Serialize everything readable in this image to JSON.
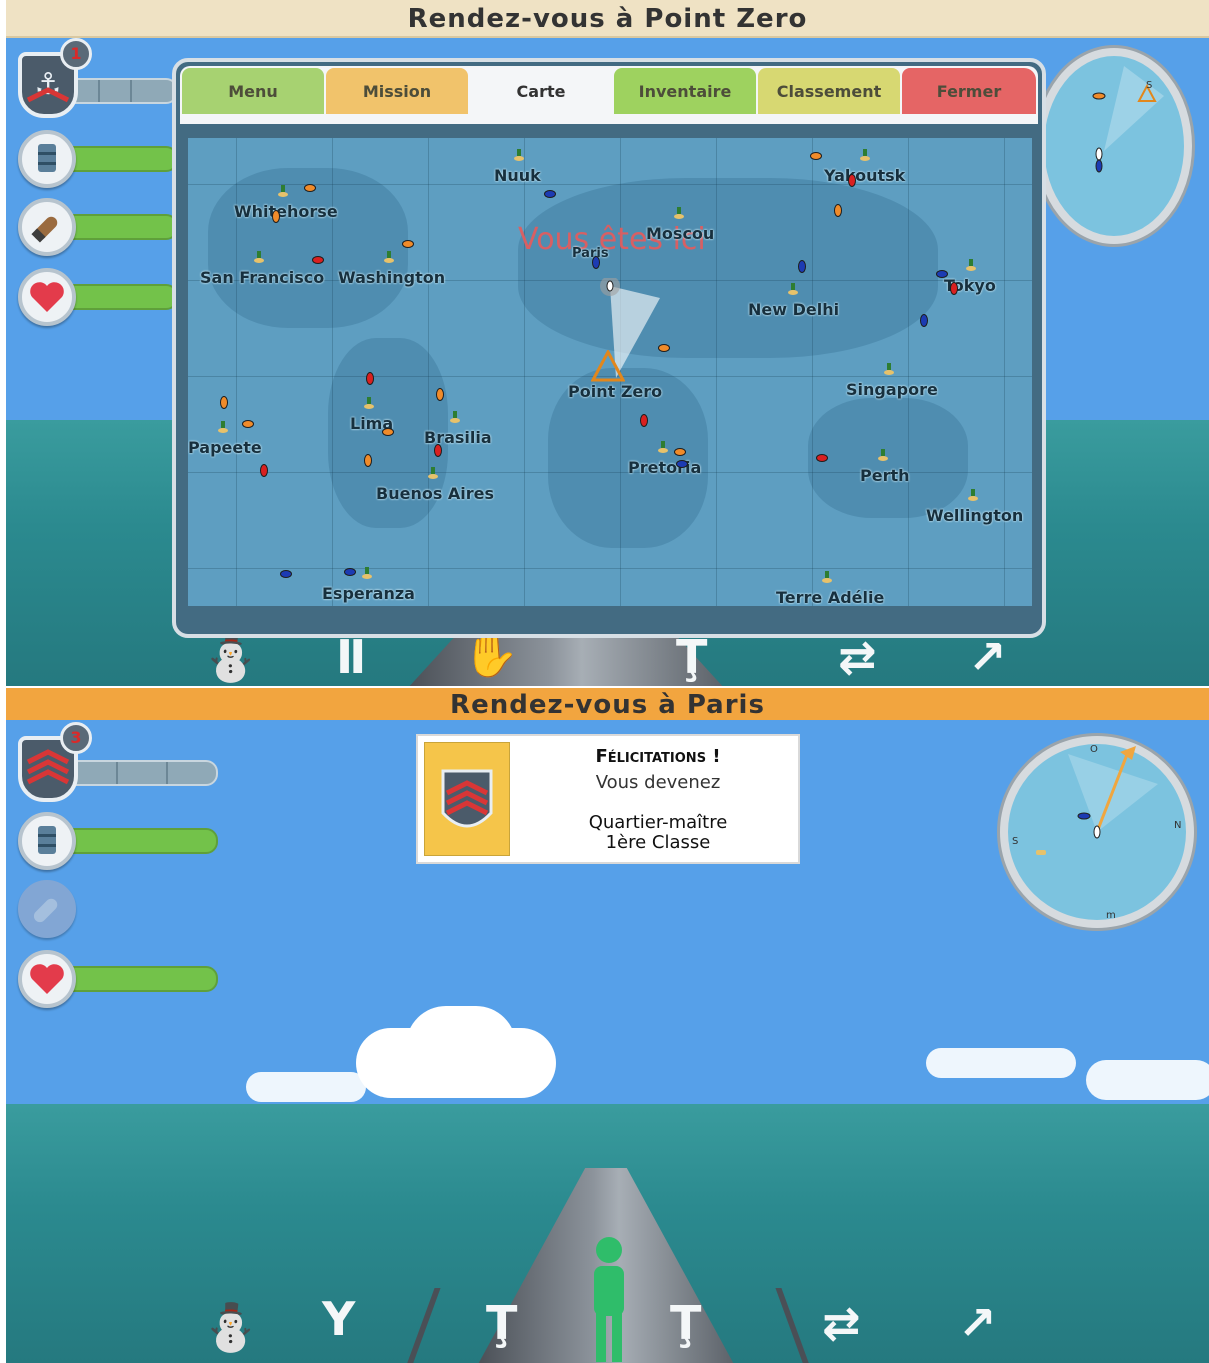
{
  "screen1": {
    "title": "Rendez-vous à Point Zero",
    "rank_badge_number": "1",
    "tabs": [
      {
        "label": "Menu",
        "color": "#a7d271"
      },
      {
        "label": "Mission",
        "color": "#f1c36b"
      },
      {
        "label": "Carte",
        "color": "#f4f6f8"
      },
      {
        "label": "Inventaire",
        "color": "#9ed25f"
      },
      {
        "label": "Classement",
        "color": "#d7d872"
      },
      {
        "label": "Fermer",
        "color": "#e56565"
      }
    ],
    "map": {
      "you_are_here": "Vous êtes ici",
      "cities": [
        "Nuuk",
        "Yakoutsk",
        "Whitehorse",
        "Moscou",
        "Paris",
        "San Francisco",
        "Washington",
        "Tokyo",
        "New Delhi",
        "Point Zero",
        "Singapore",
        "Papeete",
        "Lima",
        "Brasilia",
        "Pretoria",
        "Perth",
        "Buenos Aires",
        "Wellington",
        "Esperanza",
        "Terre Adélie"
      ]
    },
    "stats": [
      "fuel-icon",
      "torpedo-icon",
      "heart-icon"
    ]
  },
  "screen2": {
    "title": "Rendez-vous à Paris",
    "rank_badge_number": "3",
    "popup": {
      "heading": "Félicitations !",
      "line1": "Vous devenez",
      "rank_line1": "Quartier-maître",
      "rank_line2": "1ère Classe"
    },
    "compass_letters": [
      "O",
      "N",
      "S",
      "m"
    ]
  },
  "colors": {
    "accent_title_bar": "#f2a53f",
    "health_bar": "#73c24a",
    "sky": "#56a0e9",
    "sea": "#2b8a8f"
  }
}
